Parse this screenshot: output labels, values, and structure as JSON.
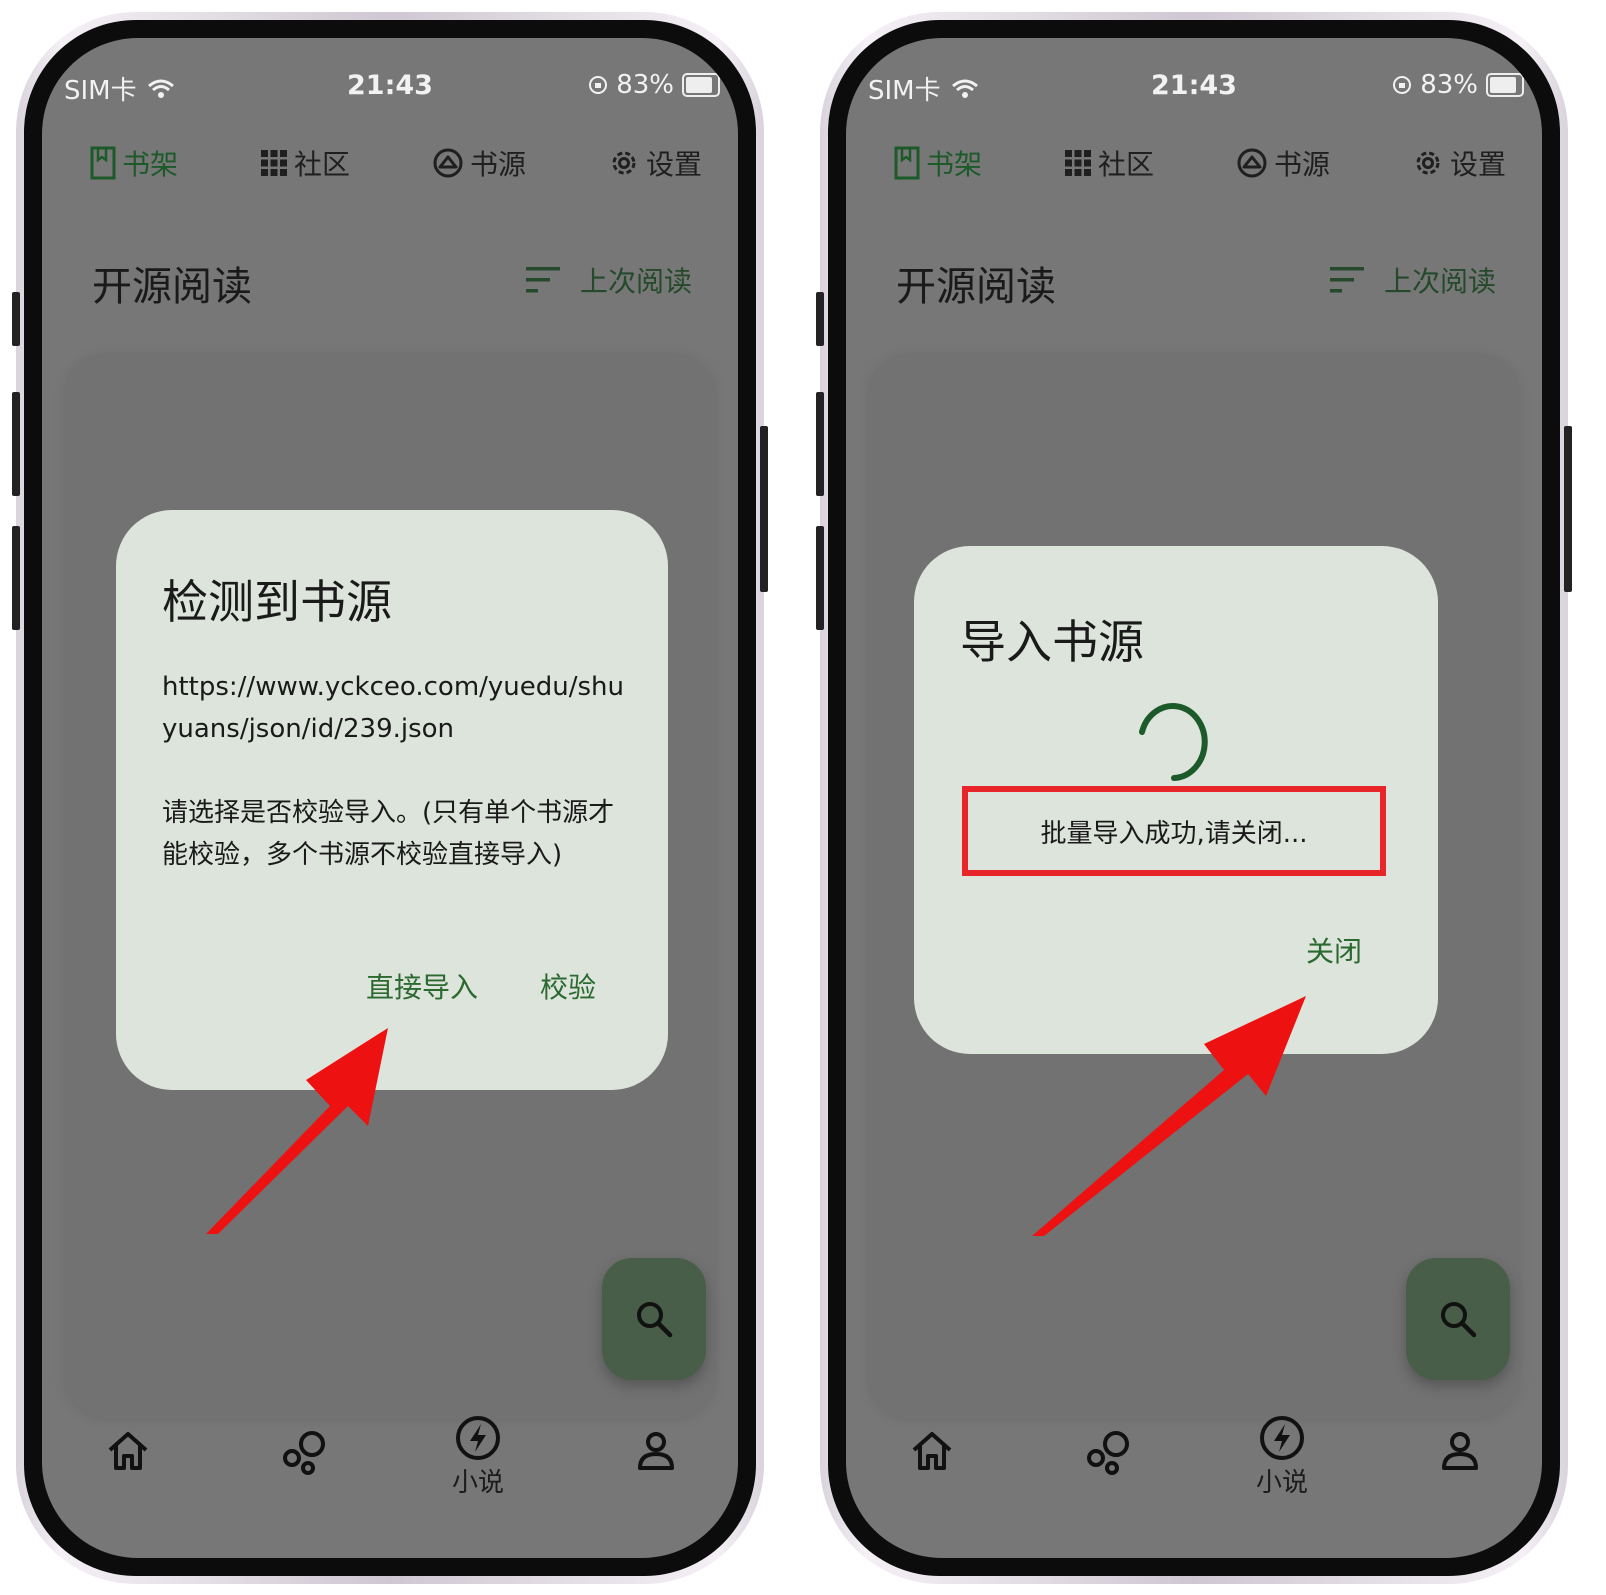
{
  "colors": {
    "accent": "#1d5a2a",
    "dialog_bg": "#dde4dc",
    "screen_overlay": "#777777",
    "fab_bg": "#485e48",
    "annotation_red": "#e8262a"
  },
  "status_bar": {
    "carrier": "SIM卡",
    "time": "21:43",
    "battery": "83%"
  },
  "top_nav": [
    {
      "label": "书架",
      "icon": "bookshelf-icon",
      "active": true
    },
    {
      "label": "社区",
      "icon": "grid-icon",
      "active": false
    },
    {
      "label": "书源",
      "icon": "source-icon",
      "active": false
    },
    {
      "label": "设置",
      "icon": "gear-icon",
      "active": false
    }
  ],
  "header": {
    "title": "开源阅读",
    "sort_label": "上次阅读",
    "sort_icon": "sort-icon"
  },
  "fab": {
    "icon": "search-icon"
  },
  "bottom_nav": [
    {
      "label": "",
      "icon": "home-icon"
    },
    {
      "label": "",
      "icon": "bubbles-icon"
    },
    {
      "label": "小说",
      "icon": "lightning-icon"
    },
    {
      "label": "",
      "icon": "user-icon"
    }
  ],
  "dialog_detect": {
    "title": "检测到书源",
    "url": "https://www.yckceo.com/yuedu/shuyuans/json/id/239.json",
    "message": " 请选择是否校验导入。(只有单个书源才能校验，多个书源不校验直接导入)",
    "direct_import": "直接导入",
    "verify": "校验"
  },
  "dialog_import": {
    "title": "导入书源",
    "status": "批量导入成功,请关闭...",
    "close": "关闭"
  }
}
